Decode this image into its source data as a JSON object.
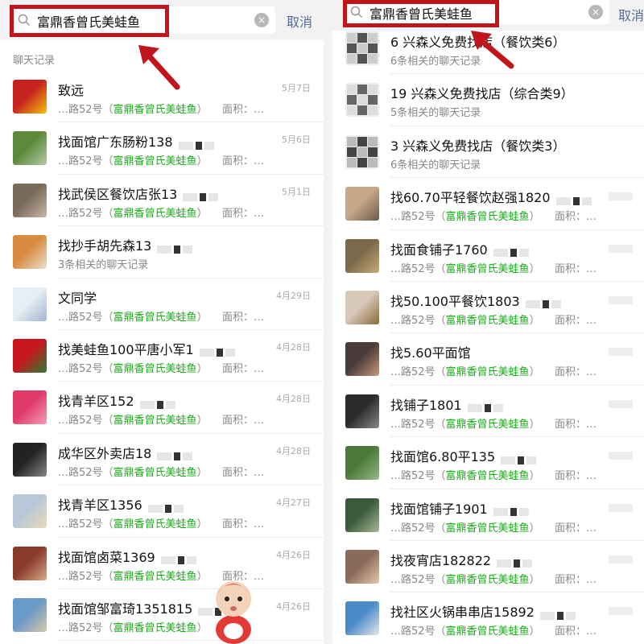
{
  "search": {
    "query": "富鼎香曾氏美蛙鱼",
    "cancel_label": "取消",
    "clear_glyph": "×"
  },
  "left": {
    "section_header": "聊天记录",
    "items": [
      {
        "name": "致远",
        "date": "5月7日",
        "sub_prefix": "…路52号（",
        "keyword": "富鼎香曾氏美蛙鱼",
        "sub_suffix": "）",
        "area": "面积：…",
        "avatar_colors": [
          "#c5221f",
          "#f4c20d"
        ]
      },
      {
        "name": "找面馆广东肠粉138",
        "date": "5月6日",
        "sub_prefix": "…路52号（",
        "keyword": "富鼎香曾氏美蛙鱼",
        "sub_suffix": "）",
        "area": "面积：…",
        "avatar_colors": [
          "#5c8a3a",
          "#b7c9a8"
        ]
      },
      {
        "name": "找武侯区餐饮店张13",
        "date": "5月1日",
        "sub_prefix": "…路52号（",
        "keyword": "富鼎香曾氏美蛙鱼",
        "sub_suffix": "）",
        "area": "面积：…",
        "avatar_colors": [
          "#7a6a5a",
          "#c9b8a8"
        ]
      },
      {
        "name": "找抄手胡先森13",
        "date": "",
        "sub_text": "3条相关的聊天记录",
        "avatar_colors": [
          "#d98c3f",
          "#e8e0d0"
        ]
      },
      {
        "name": "文同学",
        "date": "4月29日",
        "sub_prefix": "…路52号（",
        "keyword": "富鼎香曾氏美蛙鱼",
        "sub_suffix": "）",
        "area": "面积：…",
        "avatar_colors": [
          "#e8eef5",
          "#9fb6d1"
        ]
      },
      {
        "name": "找美蛙鱼100平唐小军1",
        "date": "4月28日",
        "sub_prefix": "…路52号（",
        "keyword": "富鼎香曾氏美蛙鱼",
        "sub_suffix": "）",
        "area": "面积：…",
        "avatar_colors": [
          "#c8161d",
          "#2e7d32"
        ]
      },
      {
        "name": "找青羊区152",
        "date": "4月28日",
        "sub_prefix": "…路52号（",
        "keyword": "富鼎香曾氏美蛙鱼",
        "sub_suffix": "）",
        "area": "面积：…",
        "avatar_colors": [
          "#e03a6b",
          "#f59bb6"
        ]
      },
      {
        "name": "成华区外卖店18",
        "date": "4月28日",
        "sub_prefix": "…路52号（",
        "keyword": "富鼎香曾氏美蛙鱼",
        "sub_suffix": "）",
        "area": "面积：…",
        "avatar_colors": [
          "#222222",
          "#888888"
        ]
      },
      {
        "name": "找青羊区1356",
        "date": "4月27日",
        "sub_prefix": "…路52号（",
        "keyword": "富鼎香曾氏美蛙鱼",
        "sub_suffix": "）",
        "area": "面积：…",
        "avatar_colors": [
          "#b8c8d8",
          "#e8d8b8"
        ]
      },
      {
        "name": "找面馆卤菜1369",
        "date": "4月26日",
        "sub_prefix": "…路52号（",
        "keyword": "富鼎香曾氏美蛙鱼",
        "sub_suffix": "）",
        "area": "面积：…",
        "avatar_colors": [
          "#8a3a2a",
          "#d8a888"
        ]
      },
      {
        "name": "找面馆邹富琦1351815",
        "date": "4月26日",
        "sub_prefix": "…路52号（",
        "keyword": "富鼎香曾氏美蛙鱼",
        "sub_suffix": "）",
        "area": "",
        "avatar_colors": [
          "#6a9ac8",
          "#d8c8a8"
        ]
      }
    ]
  },
  "right": {
    "items": [
      {
        "name": "6 兴森义免费找店（餐饮类6）",
        "date": "",
        "sub_text": "6条相关的聊天记录",
        "avatar_colors": [
          "#555555",
          "#cccccc"
        ],
        "group": true
      },
      {
        "name": "19 兴森义免费找店（综合类9）",
        "date": "",
        "sub_text": "5条相关的聊天记录",
        "avatar_colors": [
          "#666666",
          "#dddddd"
        ],
        "group": true
      },
      {
        "name": "3 兴森义免费找店（餐饮类3）",
        "date": "",
        "sub_text": "6条相关的聊天记录",
        "avatar_colors": [
          "#444444",
          "#bbbbbb"
        ],
        "group": true
      },
      {
        "name": "找60.70平轻餐饮赵强1820",
        "date": "",
        "sub_prefix": "…路52号（",
        "keyword": "富鼎香曾氏美蛙鱼",
        "sub_suffix": "）",
        "area": "面积：…",
        "avatar_colors": [
          "#c8a888",
          "#6a5a4a"
        ]
      },
      {
        "name": "找面食铺子1760",
        "date": "",
        "sub_prefix": "…路52号（",
        "keyword": "富鼎香曾氏美蛙鱼",
        "sub_suffix": "）",
        "area": "面积：…",
        "avatar_colors": [
          "#7a6a4a",
          "#c8a878"
        ]
      },
      {
        "name": "找50.100平餐饮1803",
        "date": "",
        "sub_prefix": "…路52号（",
        "keyword": "富鼎香曾氏美蛙鱼",
        "sub_suffix": "）",
        "area": "面积：…",
        "avatar_colors": [
          "#d8c8b8",
          "#8a6a3a"
        ]
      },
      {
        "name": "找5.60平面馆",
        "date": "",
        "sub_prefix": "…路52号（",
        "keyword": "富鼎香曾氏美蛙鱼",
        "sub_suffix": "）",
        "area": "面积：…",
        "avatar_colors": [
          "#4a3a3a",
          "#c89878"
        ]
      },
      {
        "name": "找铺子1801",
        "date": "",
        "sub_prefix": "…路52号（",
        "keyword": "富鼎香曾氏美蛙鱼",
        "sub_suffix": "）",
        "area": "面积：…",
        "avatar_colors": [
          "#2a2a2a",
          "#888888"
        ]
      },
      {
        "name": "找面馆6.80平135",
        "date": "",
        "sub_prefix": "…路52号（",
        "keyword": "富鼎香曾氏美蛙鱼",
        "sub_suffix": "）",
        "area": "面积：…",
        "avatar_colors": [
          "#4a7a3a",
          "#98b888"
        ]
      },
      {
        "name": "找面馆铺子1901",
        "date": "",
        "sub_prefix": "…路52号（",
        "keyword": "富鼎香曾氏美蛙鱼",
        "sub_suffix": "）",
        "area": "面积：…",
        "avatar_colors": [
          "#3a5a3a",
          "#a8b898"
        ]
      },
      {
        "name": "找夜宵店182822",
        "date": "",
        "sub_prefix": "…路52号（",
        "keyword": "富鼎香曾氏美蛙鱼",
        "sub_suffix": "）",
        "area": "面积：…",
        "avatar_colors": [
          "#8a6a5a",
          "#e8c8a8"
        ]
      },
      {
        "name": "找社区火锅串串店15892",
        "date": "",
        "sub_prefix": "…路52号（",
        "keyword": "富鼎香曾氏美蛙鱼",
        "sub_suffix": "）",
        "area": "面积：…",
        "avatar_colors": [
          "#4a8ac8",
          "#e8e8e8"
        ]
      }
    ]
  },
  "colors": {
    "highlight": "#c0151b",
    "keyword": "#1aad19",
    "cancel": "#576b95"
  }
}
